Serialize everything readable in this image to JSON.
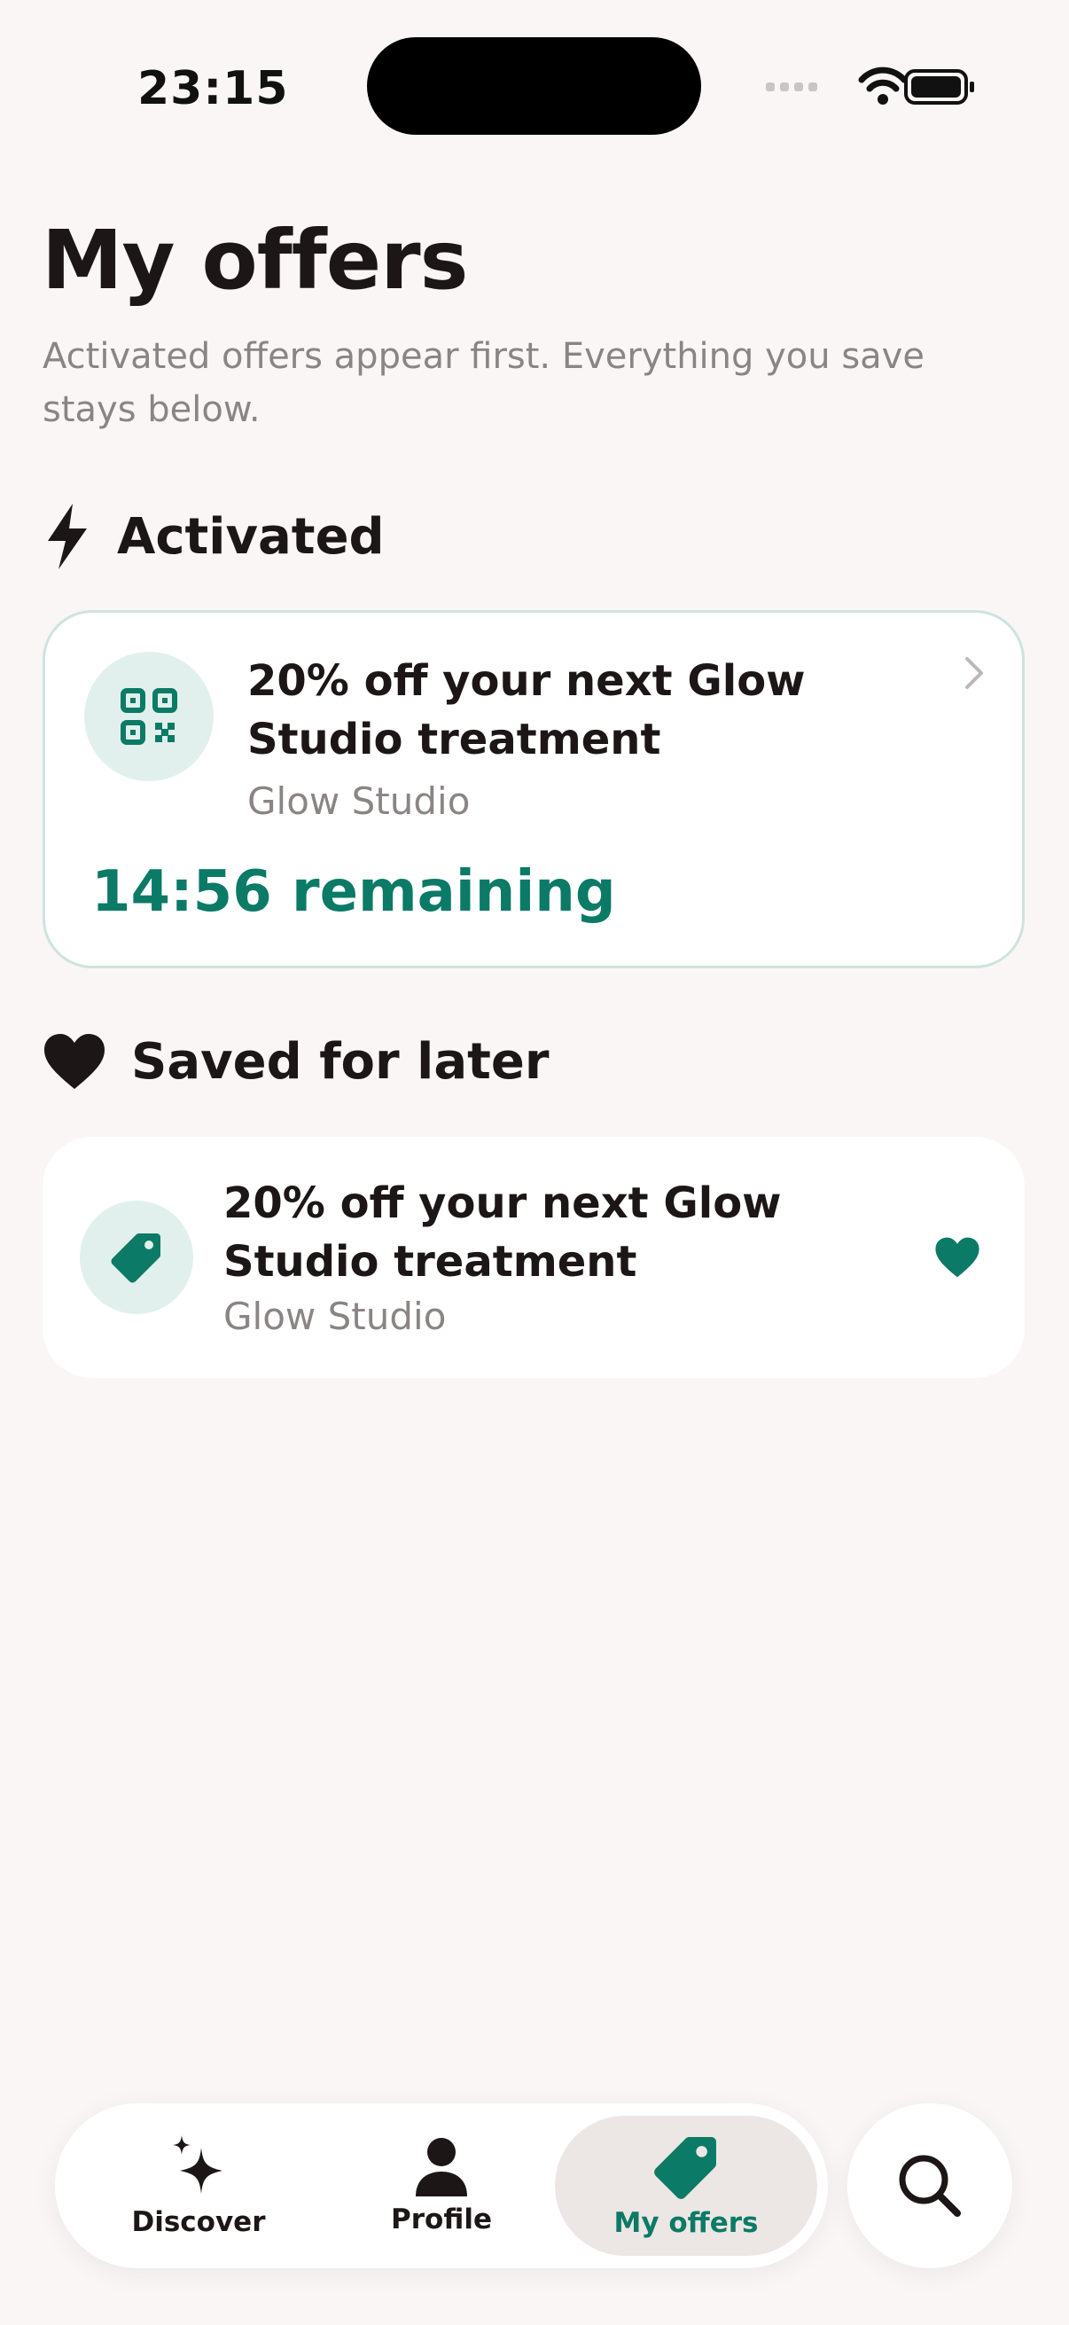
{
  "status_bar": {
    "time": "23:15"
  },
  "page": {
    "title": "My offers",
    "subtitle": "Activated offers appear first. Everything you save stays below."
  },
  "activated": {
    "section_label": "Activated",
    "section_icon": "bolt-icon",
    "offer": {
      "title": "20% off your next Glow Studio treatment",
      "merchant": "Glow Studio",
      "countdown": "14:56 remaining",
      "icon": "qr-code-icon"
    }
  },
  "saved": {
    "section_label": "Saved for later",
    "section_icon": "heart-icon",
    "offer": {
      "title": "20% off your next Glow Studio treatment",
      "merchant": "Glow Studio",
      "icon": "tag-icon",
      "favorite_icon": "heart-filled-icon"
    }
  },
  "tab_bar": {
    "tabs": [
      {
        "label": "Discover",
        "icon": "sparkles-icon"
      },
      {
        "label": "Profile",
        "icon": "person-icon"
      },
      {
        "label": "My offers",
        "icon": "tag-icon",
        "active": true
      }
    ],
    "search_icon": "search-icon"
  },
  "colors": {
    "accent": "#0b7a66",
    "background": "#f9f6f5",
    "text": "#1c1716",
    "muted": "#8a8584",
    "icon_bg": "#e1f0ec"
  }
}
